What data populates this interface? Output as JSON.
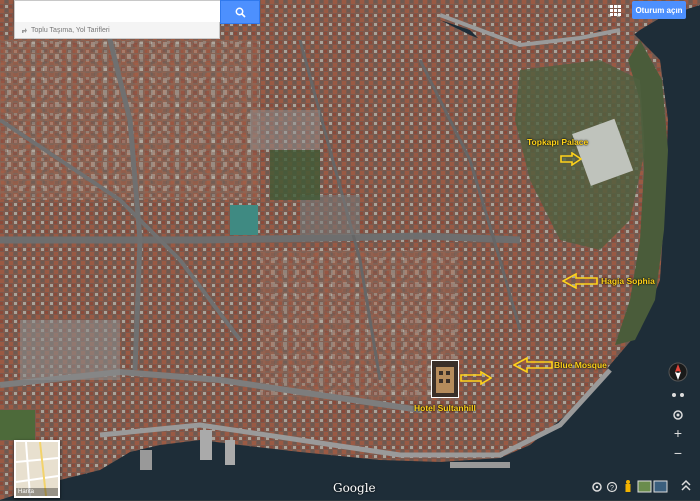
{
  "search": {
    "placeholder": "",
    "transit_label": "Toplu Taşıma, Yol Tarifleri"
  },
  "header": {
    "signin_label": "Oturum açın",
    "apps_icon": "apps-grid-icon",
    "search_icon": "search-icon"
  },
  "landmarks": [
    {
      "label": "Topkapı Palace"
    },
    {
      "label": "Hagia Sophia"
    },
    {
      "label": "Blue Mosque"
    },
    {
      "label": "Hotel Sultanhill"
    }
  ],
  "minimap": {
    "label": "Harita"
  },
  "footer": {
    "google_logo": "Google"
  },
  "colors": {
    "annotation": "#ffd21a",
    "water": "#1e2d38",
    "accent": "#4d90fe"
  }
}
